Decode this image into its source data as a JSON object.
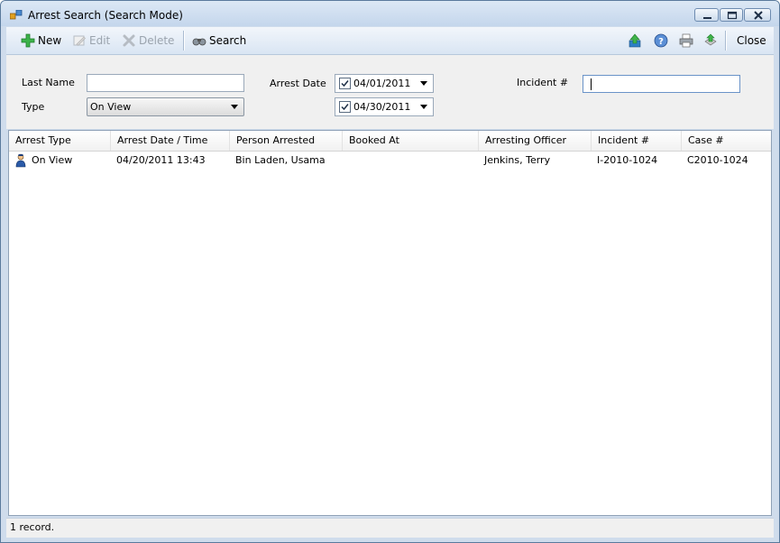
{
  "window": {
    "title": "Arrest Search (Search Mode)"
  },
  "toolbar": {
    "new_label": "New",
    "edit_label": "Edit",
    "delete_label": "Delete",
    "search_label": "Search",
    "close_label": "Close",
    "icons": [
      "upload-icon",
      "help-icon",
      "print-icon",
      "export-icon"
    ]
  },
  "filters": {
    "last_name_label": "Last Name",
    "last_name_value": "",
    "type_label": "Type",
    "type_value": "On View",
    "arrest_date_label": "Arrest Date",
    "date_from": "04/01/2011",
    "date_to": "04/30/2011",
    "incident_label": "Incident #",
    "incident_value": ""
  },
  "table": {
    "columns": [
      "Arrest Type",
      "Arrest Date / Time",
      "Person Arrested",
      "Booked At",
      "Arresting Officer",
      "Incident #",
      "Case #"
    ],
    "rows": [
      [
        "On View",
        "04/20/2011 13:43",
        "Bin Laden, Usama",
        "",
        "Jenkins, Terry",
        "I-2010-1024",
        "C2010-1024"
      ]
    ]
  },
  "status": {
    "text": "1 record."
  }
}
